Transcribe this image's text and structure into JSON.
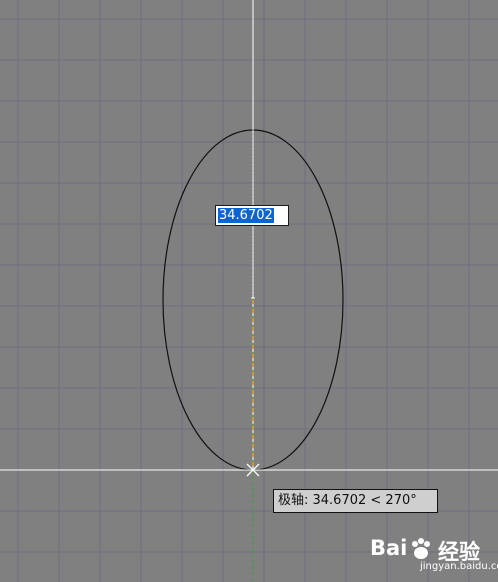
{
  "dynamic_input": {
    "value": "34.6702"
  },
  "tooltip": {
    "text": "极轴: 34.6702 < 270°"
  },
  "watermark": {
    "logo": "Bai",
    "logo_suffix": "经验",
    "site": "jingyan.baidu.com"
  },
  "colors": {
    "background": "#808080",
    "grid": "#6e6e80",
    "crosshair": "#ffffff",
    "ellipse": "#111111",
    "tracking_orange": "#e0a030",
    "tracking_green": "#3aa03a",
    "selection": "#0a64d2"
  },
  "icons": {
    "cursor": "crosshair-icon",
    "snap": "snap-marker-icon",
    "watermark_paw": "paw-icon"
  }
}
